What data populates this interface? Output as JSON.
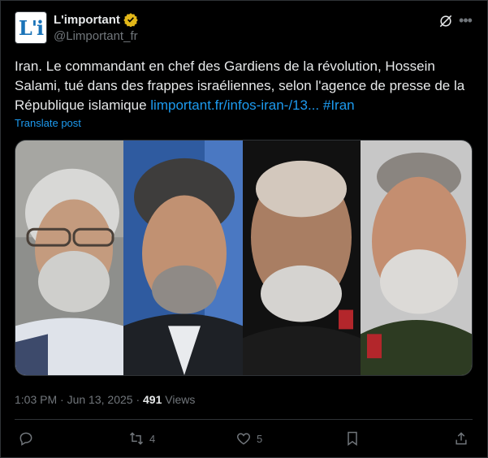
{
  "account": {
    "display_name": "L'important",
    "handle": "@Limportant_fr",
    "avatar_text": "L'i"
  },
  "post": {
    "text": "Iran. Le commandant en chef des Gardiens de la révolution, Hossein Salami, tué dans des frappes israéliennes, selon l'agence de presse de la République islamique ",
    "link": "limportant.fr/infos-iran-/13...",
    "hashtag": "#Iran",
    "translate_label": "Translate post"
  },
  "meta": {
    "time": "1:03 PM",
    "date": "Jun 13, 2025",
    "views_count": "491",
    "views_label": "Views"
  },
  "actions": {
    "retweets": "4",
    "likes": "5"
  },
  "colors": {
    "accent": "#1d9bf0",
    "verified_gold": "#e2b719",
    "muted": "#71767b"
  }
}
